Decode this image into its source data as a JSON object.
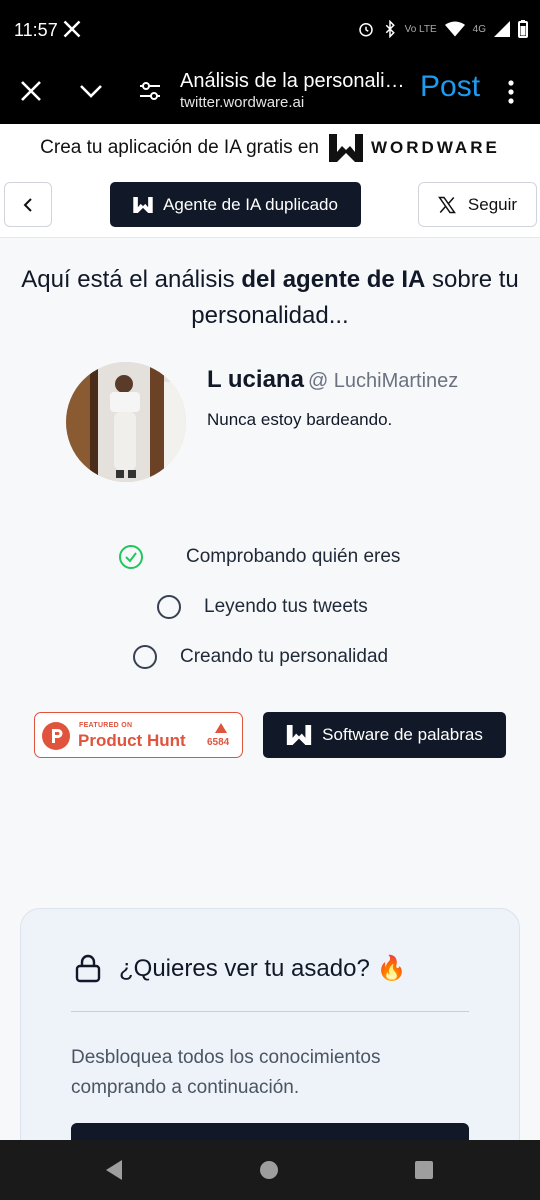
{
  "status_bar": {
    "time": "11:57",
    "network": "4G",
    "volte": "Vo LTE"
  },
  "browser": {
    "title": "Análisis de la personalidad de Luciana",
    "url": "twitter.wordware.ai",
    "post_label": "Post"
  },
  "banner": {
    "text": "Crea tu aplicación de IA gratis en",
    "brand": "WORDWARE"
  },
  "nav": {
    "duplicate_label": "Agente de IA duplicado",
    "follow_label": "Seguir"
  },
  "headline": {
    "part1": "Aquí está el análisis ",
    "bold": "del agente de IA",
    "part2": " sobre tu personalidad..."
  },
  "profile": {
    "name": "L uciana",
    "handle": "@ LuchiMartinez",
    "bio": "Nunca estoy bardeando."
  },
  "steps": [
    {
      "label": "Comprobando quién eres",
      "status": "done"
    },
    {
      "label": "Leyendo tus tweets",
      "status": "pending"
    },
    {
      "label": "Creando tu personalidad",
      "status": "pending"
    }
  ],
  "product_hunt": {
    "featured": "FEATURED ON",
    "name": "Product Hunt",
    "count": "6584"
  },
  "software_label": "Software de palabras",
  "roast": {
    "title": "¿Quieres ver tu asado? 🔥",
    "description": "Desbloquea todos los conocimientos comprando a continuación."
  },
  "colors": {
    "dark": "#111827",
    "accent_blue": "#1d9bf0",
    "product_hunt": "#e0533d",
    "check_green": "#22c55e"
  }
}
